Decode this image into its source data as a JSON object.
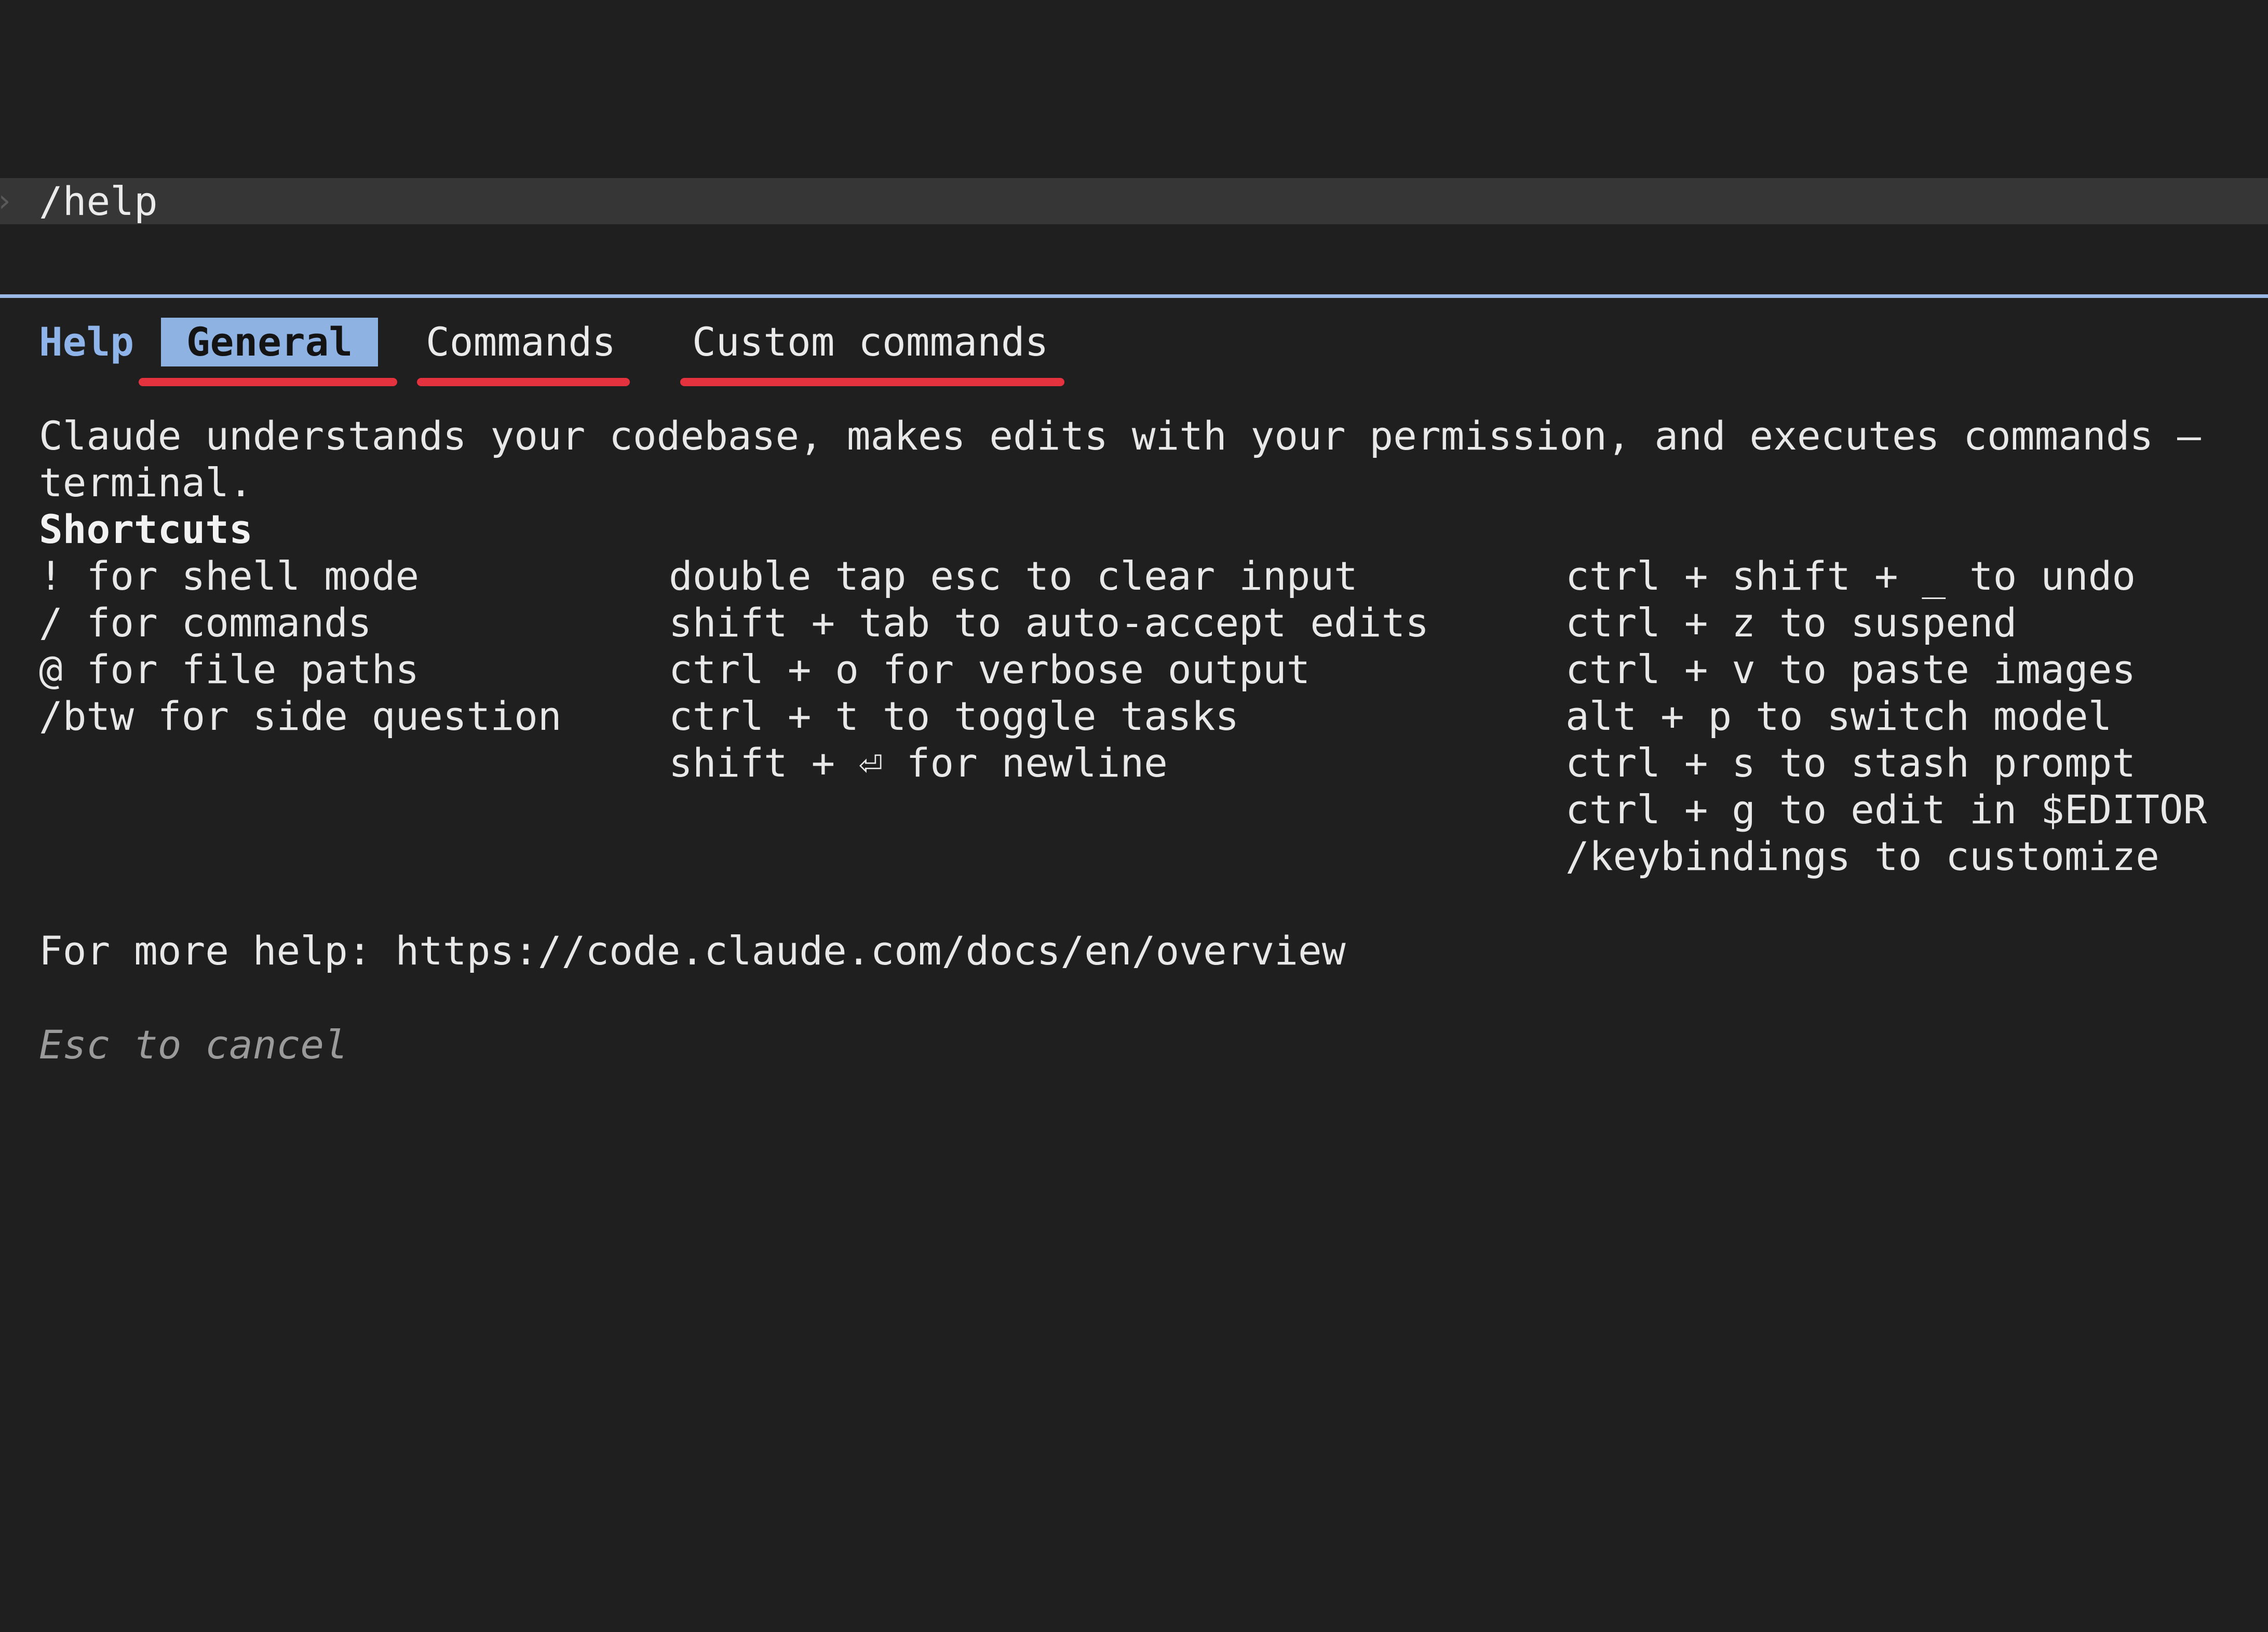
{
  "prompt": {
    "text": "/help"
  },
  "tabs": {
    "help_label": "Help",
    "items": [
      {
        "label": "General",
        "selected": true
      },
      {
        "label": "Commands",
        "selected": false
      },
      {
        "label": "Custom commands",
        "selected": false
      }
    ]
  },
  "content": {
    "description_line1": "Claude understands your codebase, makes edits with your permission, and executes commands —",
    "description_line2": "terminal.",
    "shortcuts_heading": "Shortcuts",
    "columns": [
      [
        "! for shell mode",
        "/ for commands",
        "@ for file paths",
        "/btw for side question"
      ],
      [
        "double tap esc to clear input",
        "shift + tab to auto-accept edits",
        "ctrl + o for verbose output",
        "ctrl + t to toggle tasks",
        "shift + ⏎ for newline"
      ],
      [
        "ctrl + shift + _ to undo",
        "ctrl + z to suspend",
        "ctrl + v to paste images",
        "alt + p to switch model",
        "ctrl + s to stash prompt",
        "ctrl + g to edit in $EDITOR",
        "/keybindings to customize"
      ]
    ],
    "more_help": "For more help: https://code.claude.com/docs/en/overview",
    "esc_hint": "Esc to cancel"
  },
  "colors": {
    "background": "#1f1f1f",
    "accent_blue": "#8eb2e2",
    "annotation_red": "#e5323f"
  }
}
